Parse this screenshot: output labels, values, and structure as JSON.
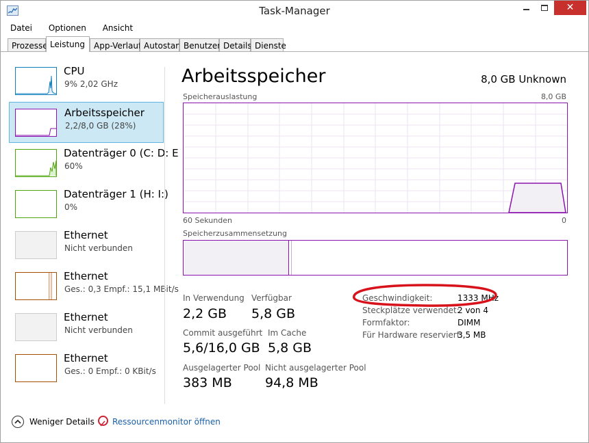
{
  "window": {
    "title": "Task-Manager",
    "close_glyph": "✕"
  },
  "menu": [
    "Datei",
    "Optionen",
    "Ansicht"
  ],
  "tabs": [
    "Prozesse",
    "Leistung",
    "App-Verlauf",
    "Autostart",
    "Benutzer",
    "Details",
    "Dienste"
  ],
  "active_tab": "Leistung",
  "sidebar": {
    "items": [
      {
        "name": "CPU",
        "sub": "9% 2,02 GHz",
        "color": "#117dbb",
        "icon": "cpu-graph"
      },
      {
        "name": "Arbeitsspeicher",
        "sub": "2,2/8,0 GB (28%)",
        "color": "#8b12ae",
        "icon": "memory-graph",
        "active": true
      },
      {
        "name": "Datenträger 0 (C: D: E",
        "sub": "60%",
        "color": "#4da60c",
        "icon": "disk-graph"
      },
      {
        "name": "Datenträger 1 (H: I:)",
        "sub": "0%",
        "color": "#4da60c",
        "icon": "disk-graph"
      },
      {
        "name": "Ethernet",
        "sub": "Nicht verbunden",
        "color": "#cccccc",
        "icon": "ethernet-graph"
      },
      {
        "name": "Ethernet",
        "sub": "Ges.: 0,3  Empf.: 15,1 MBit/s",
        "color": "#a74f01",
        "icon": "ethernet-graph"
      },
      {
        "name": "Ethernet",
        "sub": "Nicht verbunden",
        "color": "#cccccc",
        "icon": "ethernet-graph"
      },
      {
        "name": "Ethernet",
        "sub": "Ges.: 0  Empf.: 0 KBit/s",
        "color": "#a74f01",
        "icon": "ethernet-graph"
      }
    ]
  },
  "main": {
    "title": "Arbeitsspeicher",
    "device": "8,0 GB Unknown",
    "usage_label": "Speicherauslastung",
    "usage_max": "8,0 GB",
    "time_label": "60 Sekunden",
    "time_min": "0",
    "composition_label": "Speicherzusammensetzung",
    "stats": {
      "in_use_label": "In Verwendung",
      "in_use": "2,2 GB",
      "available_label": "Verfügbar",
      "available": "5,8 GB",
      "committed_label": "Commit ausgeführt",
      "committed": "5,6/16,0 GB",
      "cached_label": "Im Cache",
      "cached": "5,8 GB",
      "paged_label": "Ausgelagerter Pool",
      "paged": "383 MB",
      "nonpaged_label": "Nicht ausgelagerter Pool",
      "nonpaged": "94,8 MB"
    },
    "specs": {
      "speed_label": "Geschwindigkeit:",
      "speed": "1333 MHz",
      "slots_label": "Steckplätze verwendet:",
      "slots": "2 von 4",
      "form_label": "Formfaktor:",
      "form": "DIMM",
      "reserved_label": "Für Hardware reserviert:",
      "reserved": "3,5 MB"
    },
    "accent_color": "#8b12ae",
    "annotation_color": "#d8121b"
  },
  "footer": {
    "fewer_details": "Weniger Details",
    "resource_monitor": "Ressourcenmonitor öffnen"
  }
}
